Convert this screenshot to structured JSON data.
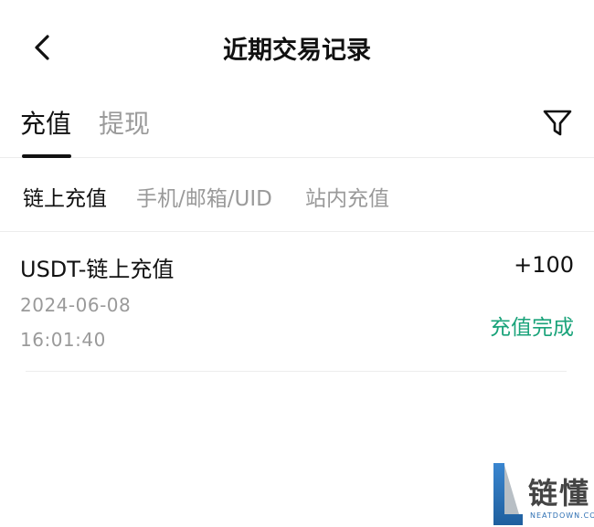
{
  "header": {
    "title": "近期交易记录",
    "back_icon": "chevron-left-icon"
  },
  "tabs": [
    {
      "label": "充值",
      "active": true
    },
    {
      "label": "提现",
      "active": false
    }
  ],
  "filter_icon": "filter-funnel-icon",
  "subtabs": [
    {
      "label": "链上充值",
      "active": true
    },
    {
      "label": "手机/邮箱/UID",
      "active": false
    },
    {
      "label": "站内充值",
      "active": false
    }
  ],
  "records": [
    {
      "title": "USDT-链上充值",
      "amount": "+100",
      "date": "2024-06-08",
      "time": "16:01:40",
      "status": "充值完成"
    }
  ],
  "watermark": {
    "text": "链懂",
    "sub": "NEATDOWN.COM"
  },
  "colors": {
    "status_success": "#1aa37a",
    "inactive_text": "#9a9a9a",
    "primary_text": "#111111",
    "divider": "#ececec",
    "watermark_blue": "#2d6fb3"
  }
}
